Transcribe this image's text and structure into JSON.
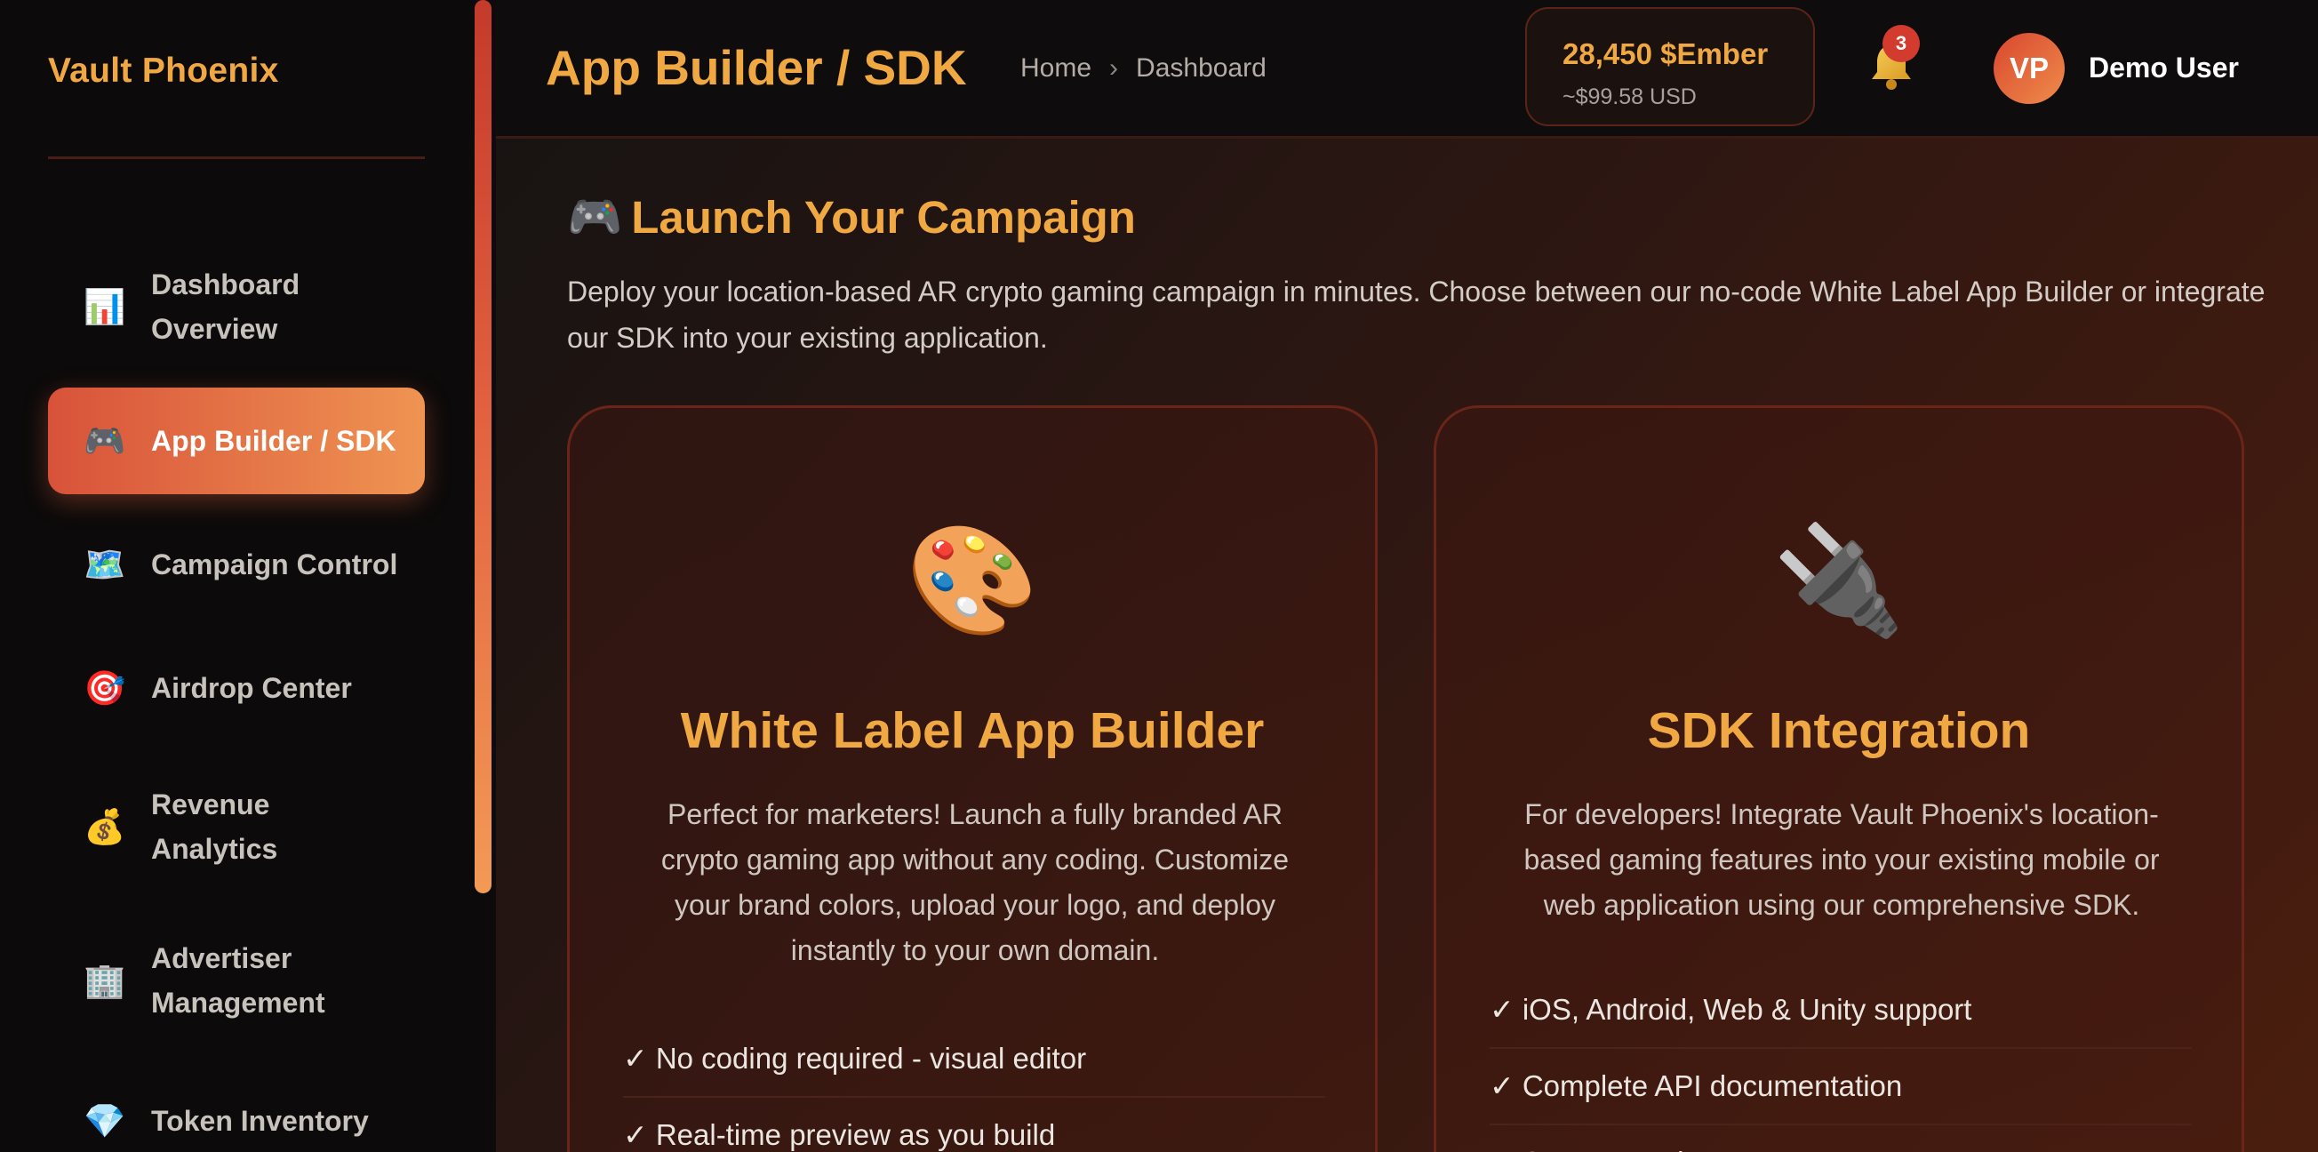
{
  "sidebar": {
    "brand": "Vault Phoenix",
    "items": [
      {
        "icon": "📊",
        "label": "Dashboard\nOverview",
        "active": false
      },
      {
        "icon": "🎮",
        "label": "App Builder / SDK",
        "active": true
      },
      {
        "icon": "🗺️",
        "label": "Campaign Control",
        "active": false
      },
      {
        "icon": "🎯",
        "label": "Airdrop Center",
        "active": false
      },
      {
        "icon": "💰",
        "label": "Revenue\nAnalytics",
        "active": false
      },
      {
        "icon": "🏢",
        "label": "Advertiser\nManagement",
        "active": false
      },
      {
        "icon": "💎",
        "label": "Token Inventory",
        "active": false
      }
    ]
  },
  "header": {
    "title": "App Builder / SDK",
    "breadcrumb": [
      "Home",
      "Dashboard"
    ],
    "breadcrumb_sep": "›",
    "balance": {
      "amount": "28,450 $Ember",
      "usd": "~$99.58 USD"
    },
    "notifications": {
      "count": "3"
    },
    "user": {
      "initials": "VP",
      "name": "Demo User"
    }
  },
  "main": {
    "section_icon": "🎮",
    "section_title": "Launch Your Campaign",
    "section_desc": "Deploy your location-based AR crypto gaming campaign in minutes. Choose between our no-code White Label App Builder or integrate our SDK into your existing application.",
    "cards": [
      {
        "emoji": "🎨",
        "title": "White Label App Builder",
        "desc": "Perfect for marketers! Launch a fully branded AR crypto gaming app without any coding. Customize your brand colors, upload your logo, and deploy instantly to your own domain.",
        "features": [
          "✓ No coding required - visual editor",
          "✓ Real-time preview as you build"
        ]
      },
      {
        "emoji": "🔌",
        "title": "SDK Integration",
        "desc": "For developers! Integrate Vault Phoenix's location-based gaming features into your existing mobile or web application using our comprehensive SDK.",
        "features": [
          "✓ iOS, Android, Web & Unity support",
          "✓ Complete API documentation",
          "✓ Secure API key management"
        ]
      }
    ]
  },
  "colors": {
    "accent": "#f0a843",
    "active_gradient_start": "#d8523a",
    "active_gradient_end": "#ef9452",
    "badge": "#d23b2e"
  }
}
